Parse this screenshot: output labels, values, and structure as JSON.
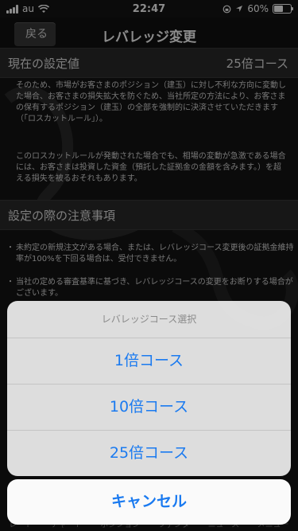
{
  "status_bar": {
    "carrier": "au",
    "time": "22:47",
    "battery": "60%",
    "battery_level": 0.6
  },
  "nav": {
    "back_label": "戻る",
    "title": "レバレッジ変更"
  },
  "current": {
    "label": "現在の設定値",
    "value": "25倍コース"
  },
  "paragraphs": [
    "そのため、市場がお客さまのポジション（建玉）に対し不利な方向に変動した場合、お客さまの損失拡大を防ぐため、当社所定の方法により、お客さまの保有するポジション（建玉）の全部を強制的に決済させていただきます（「ロスカットルール」）。",
    "このロスカットルールが発動された場合でも、相場の変動が急激である場合には、お客さまは投資した資金（預託した証拠金の金額を含みます。）を超える損失を被るおそれもあります。"
  ],
  "notes": {
    "heading": "設定の際の注意事項",
    "items": [
      "未約定の新規注文がある場合、または、レバレッジコース変更後の証拠金維持率が100%を下回る場合は、受付できません。",
      "当社の定める審査基準に基づき、レバレッジコースの変更をお断りする場合がございます。"
    ]
  },
  "tabbar": [
    "レート",
    "チャート",
    "ポジション",
    "ファンダ",
    "ニュース",
    "メニュー"
  ],
  "action_sheet": {
    "title": "レバレッジコース選択",
    "options": [
      "1倍コース",
      "10倍コース",
      "25倍コース"
    ],
    "cancel": "キャンセル"
  }
}
